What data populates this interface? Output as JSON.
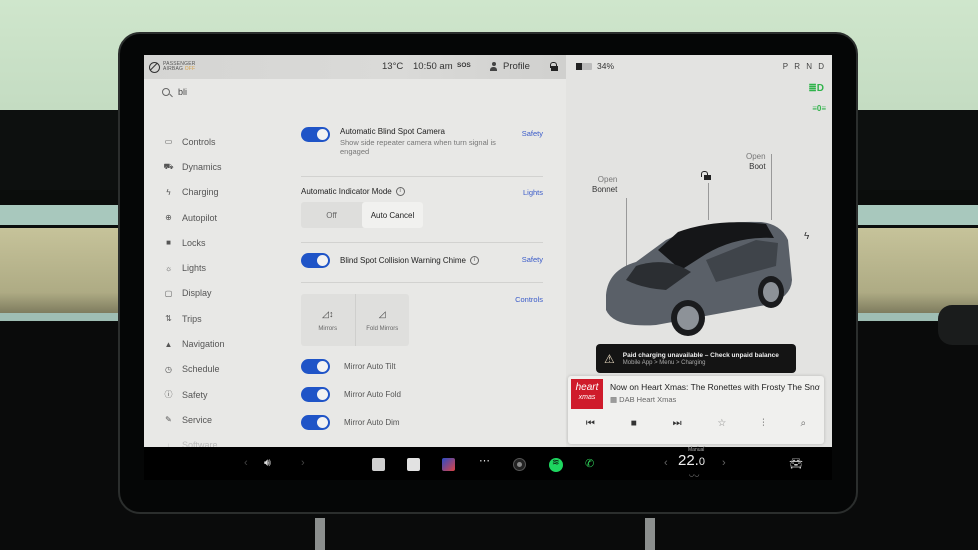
{
  "status_bar": {
    "airbag_label_line1": "PASSENGER",
    "airbag_label_line2": "AIRBAG",
    "airbag_state": "OFF",
    "temperature": "13°C",
    "time": "10:50 am",
    "sos": "SOS",
    "profile": "Profile",
    "battery_percent": "34%",
    "battery_level": 0.34,
    "gear": "P R N D"
  },
  "search": {
    "query": "bli"
  },
  "sidebar": {
    "items": [
      {
        "label": "Controls",
        "icon": "toggle-icon"
      },
      {
        "label": "Dynamics",
        "icon": "car-icon"
      },
      {
        "label": "Charging",
        "icon": "bolt-icon"
      },
      {
        "label": "Autopilot",
        "icon": "steering-wheel-icon"
      },
      {
        "label": "Locks",
        "icon": "lock-icon"
      },
      {
        "label": "Lights",
        "icon": "sun-icon"
      },
      {
        "label": "Display",
        "icon": "display-icon"
      },
      {
        "label": "Trips",
        "icon": "trips-icon"
      },
      {
        "label": "Navigation",
        "icon": "navigation-icon"
      },
      {
        "label": "Schedule",
        "icon": "schedule-icon"
      },
      {
        "label": "Safety",
        "icon": "safety-icon"
      },
      {
        "label": "Service",
        "icon": "wrench-icon"
      },
      {
        "label": "Software",
        "icon": "download-icon"
      }
    ]
  },
  "results": {
    "blind_spot_camera": {
      "title": "Automatic Blind Spot Camera",
      "subtitle": "Show side repeater camera when turn signal is engaged",
      "category": "Safety",
      "enabled": true
    },
    "indicator_mode": {
      "title": "Automatic Indicator Mode",
      "category": "Lights",
      "options": [
        "Off",
        "Auto Cancel"
      ],
      "selected": "Auto Cancel"
    },
    "collision_chime": {
      "title": "Blind Spot Collision Warning Chime",
      "category": "Safety",
      "enabled": true
    },
    "mirrors": {
      "category": "Controls",
      "buttons": [
        "Mirrors",
        "Fold Mirrors"
      ]
    },
    "mirror_toggles": [
      {
        "label": "Mirror Auto Tilt",
        "enabled": true
      },
      {
        "label": "Mirror Auto Fold",
        "enabled": true
      },
      {
        "label": "Mirror Auto Dim",
        "enabled": true
      }
    ]
  },
  "car_panel": {
    "bonnet_line1": "Open",
    "bonnet_line2": "Bonnet",
    "boot_line1": "Open",
    "boot_line2": "Boot",
    "alert_title": "Paid charging unavailable – Check unpaid balance",
    "alert_subtitle": "Mobile App > Menu > Charging"
  },
  "media": {
    "station_logo_line1": "heart",
    "station_logo_line2": "xmas",
    "now_playing": "Now on Heart Xmas: The Ronettes with Frosty The Snowman",
    "source": "DAB Heart Xmas",
    "controls": [
      "previous",
      "stop",
      "next",
      "favorite",
      "equalizer",
      "search"
    ]
  },
  "dock": {
    "climate_mode": "Manual",
    "cabin_temp_whole": "22.",
    "cabin_temp_decimal": "0"
  },
  "colors": {
    "accent": "#1f54c7",
    "link": "#3a5bc9",
    "indicator_green": "#2fb34a",
    "spotify_green": "#1ed760",
    "heart_red": "#cf1b2b"
  }
}
